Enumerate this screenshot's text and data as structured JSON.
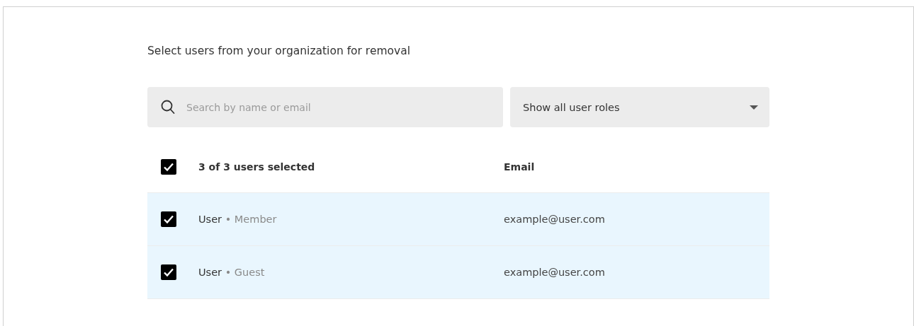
{
  "instruction": "Select users from your organization for removal",
  "search": {
    "placeholder": "Search by name or email"
  },
  "role_filter": {
    "value": "Show all user roles"
  },
  "table": {
    "header": {
      "checked": true,
      "summary": "3 of 3 users selected",
      "email_column": "Email"
    },
    "rows": [
      {
        "name": "User",
        "role": "• Member",
        "email": "example@user.com",
        "checked": true,
        "selected": true
      },
      {
        "name": "User",
        "role": "• Guest",
        "email": "example@user.com",
        "checked": true,
        "selected": true
      }
    ]
  }
}
